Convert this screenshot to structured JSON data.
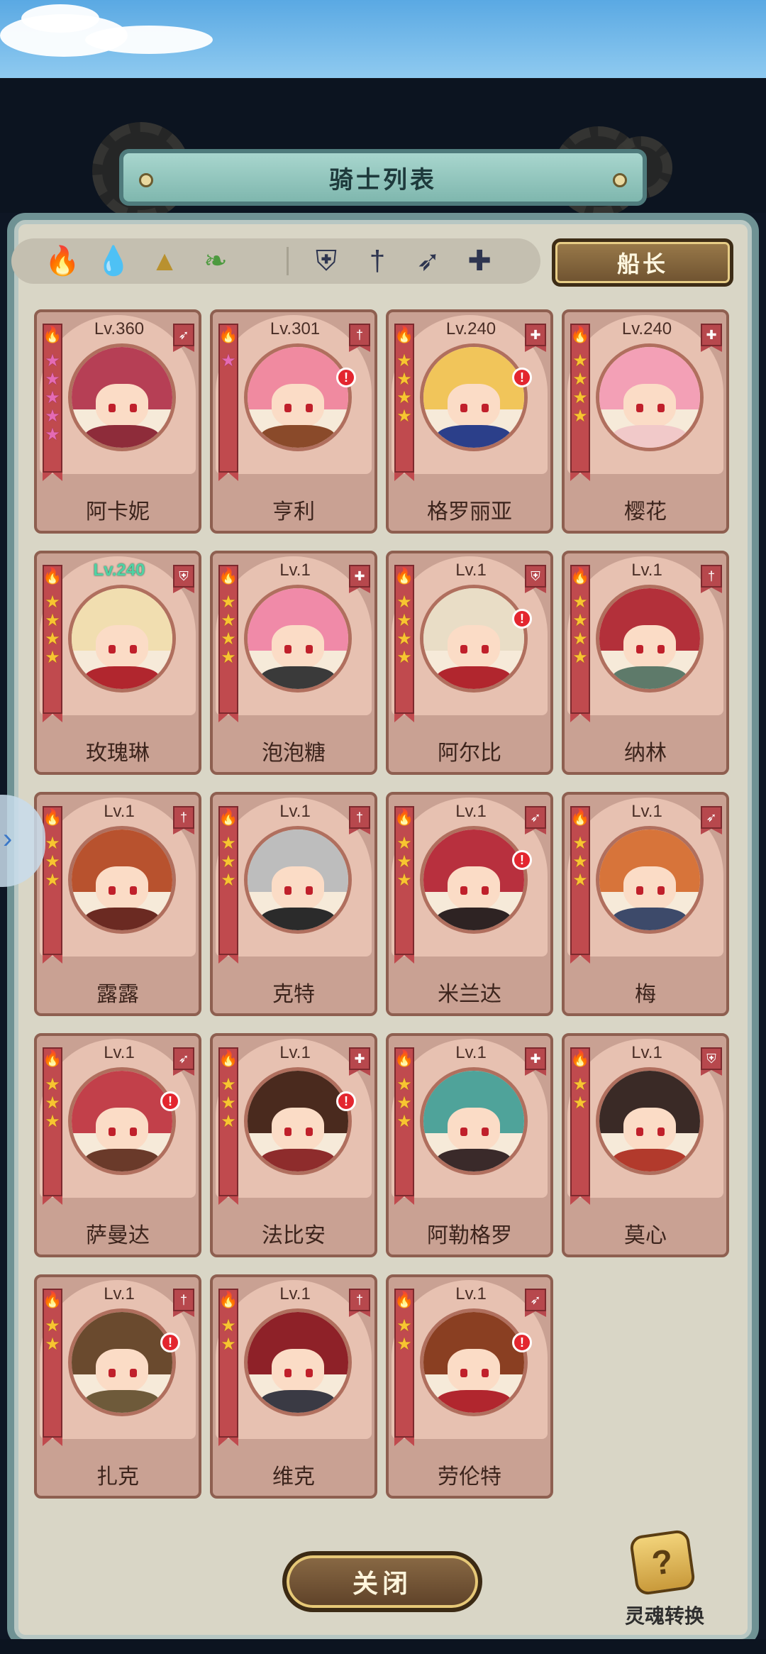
{
  "title": "骑士列表",
  "filters": {
    "elements": [
      {
        "icon": "fire-element-icon",
        "glyph": "🔥",
        "color": "#d8363c"
      },
      {
        "icon": "water-element-icon",
        "glyph": "💧",
        "color": "#3a7ad8"
      },
      {
        "icon": "earth-element-icon",
        "glyph": "▲",
        "color": "#b9912f"
      },
      {
        "icon": "wind-element-icon",
        "glyph": "❧",
        "color": "#4d9a3f"
      }
    ],
    "classes": [
      {
        "icon": "shield-class-icon",
        "glyph": "⛨"
      },
      {
        "icon": "sword-class-icon",
        "glyph": "†"
      },
      {
        "icon": "bow-class-icon",
        "glyph": "➶"
      },
      {
        "icon": "healer-class-icon",
        "glyph": "✚"
      }
    ]
  },
  "captain_label": "船长",
  "knights": [
    {
      "name": "阿卡妮",
      "level": "Lv.360",
      "stars": 5,
      "star_color": "pink",
      "class_icon": "bow-class-icon",
      "class_glyph": "➶",
      "alert": false,
      "hair": "#b63f55",
      "body": "#8e2c3a",
      "highlight": false
    },
    {
      "name": "亨利",
      "level": "Lv.301",
      "stars": 1,
      "star_color": "pink",
      "class_icon": "sword-class-icon",
      "class_glyph": "†",
      "alert": true,
      "hair": "#f08aa0",
      "body": "#8a4a2a",
      "highlight": false
    },
    {
      "name": "格罗丽亚",
      "level": "Lv.240",
      "stars": 4,
      "star_color": "gold",
      "class_icon": "healer-class-icon",
      "class_glyph": "✚",
      "alert": true,
      "hair": "#f1c55a",
      "body": "#2b3f8a",
      "highlight": false
    },
    {
      "name": "樱花",
      "level": "Lv.240",
      "stars": 4,
      "star_color": "gold",
      "class_icon": "healer-class-icon",
      "class_glyph": "✚",
      "alert": false,
      "hair": "#f3a0b6",
      "body": "#f1c9c9",
      "highlight": false
    },
    {
      "name": "玫瑰琳",
      "level": "Lv.240",
      "stars": 4,
      "star_color": "gold",
      "class_icon": "shield-class-icon",
      "class_glyph": "⛨",
      "alert": false,
      "hair": "#f1deb0",
      "body": "#b1262e",
      "highlight": true
    },
    {
      "name": "泡泡糖",
      "level": "Lv.1",
      "stars": 4,
      "star_color": "gold",
      "class_icon": "healer-class-icon",
      "class_glyph": "✚",
      "alert": false,
      "hair": "#f08aa8",
      "body": "#3a3a3a",
      "highlight": false
    },
    {
      "name": "阿尔比",
      "level": "Lv.1",
      "stars": 4,
      "star_color": "gold",
      "class_icon": "shield-class-icon",
      "class_glyph": "⛨",
      "alert": true,
      "hair": "#e9ddc6",
      "body": "#b1262e",
      "highlight": false
    },
    {
      "name": "纳林",
      "level": "Lv.1",
      "stars": 4,
      "star_color": "gold",
      "class_icon": "sword-class-icon",
      "class_glyph": "†",
      "alert": false,
      "hair": "#b3303a",
      "body": "#5e7a6a",
      "highlight": false
    },
    {
      "name": "露露",
      "level": "Lv.1",
      "stars": 3,
      "star_color": "gold",
      "class_icon": "sword-class-icon",
      "class_glyph": "†",
      "alert": false,
      "hair": "#b8522e",
      "body": "#6b2a22",
      "highlight": false
    },
    {
      "name": "克特",
      "level": "Lv.1",
      "stars": 3,
      "star_color": "gold",
      "class_icon": "sword-class-icon",
      "class_glyph": "†",
      "alert": false,
      "hair": "#bdbdbd",
      "body": "#2b2b2b",
      "highlight": false
    },
    {
      "name": "米兰达",
      "level": "Lv.1",
      "stars": 3,
      "star_color": "gold",
      "class_icon": "bow-class-icon",
      "class_glyph": "➶",
      "alert": true,
      "hair": "#b8303e",
      "body": "#2e2323",
      "highlight": false
    },
    {
      "name": "梅",
      "level": "Lv.1",
      "stars": 3,
      "star_color": "gold",
      "class_icon": "bow-class-icon",
      "class_glyph": "➶",
      "alert": false,
      "hair": "#d7743a",
      "body": "#3d4a6a",
      "highlight": false
    },
    {
      "name": "萨曼达",
      "level": "Lv.1",
      "stars": 3,
      "star_color": "gold",
      "class_icon": "bow-class-icon",
      "class_glyph": "➶",
      "alert": true,
      "hair": "#c2404a",
      "body": "#6a3a2a",
      "highlight": false
    },
    {
      "name": "法比安",
      "level": "Lv.1",
      "stars": 3,
      "star_color": "gold",
      "class_icon": "healer-class-icon",
      "class_glyph": "✚",
      "alert": true,
      "hair": "#4a2a1e",
      "body": "#8e2c2c",
      "highlight": false
    },
    {
      "name": "阿勒格罗",
      "level": "Lv.1",
      "stars": 3,
      "star_color": "gold",
      "class_icon": "healer-class-icon",
      "class_glyph": "✚",
      "alert": false,
      "hair": "#4fa39a",
      "body": "#3a2a2a",
      "highlight": false
    },
    {
      "name": "莫心",
      "level": "Lv.1",
      "stars": 2,
      "star_color": "gold",
      "class_icon": "shield-class-icon",
      "class_glyph": "⛨",
      "alert": false,
      "hair": "#3a2a26",
      "body": "#b23a2c",
      "highlight": false
    },
    {
      "name": "扎克",
      "level": "Lv.1",
      "stars": 2,
      "star_color": "gold",
      "class_icon": "sword-class-icon",
      "class_glyph": "†",
      "alert": true,
      "hair": "#6a4a2e",
      "body": "#6e5a3a",
      "highlight": false
    },
    {
      "name": "维克",
      "level": "Lv.1",
      "stars": 2,
      "star_color": "gold",
      "class_icon": "sword-class-icon",
      "class_glyph": "†",
      "alert": false,
      "hair": "#8e2128",
      "body": "#3a3a44",
      "highlight": false
    },
    {
      "name": "劳伦特",
      "level": "Lv.1",
      "stars": 2,
      "star_color": "gold",
      "class_icon": "bow-class-icon",
      "class_glyph": "➶",
      "alert": true,
      "hair": "#8a3f22",
      "body": "#b1262e",
      "highlight": false
    }
  ],
  "close_label": "关闭",
  "soul_convert_label": "灵魂转换"
}
